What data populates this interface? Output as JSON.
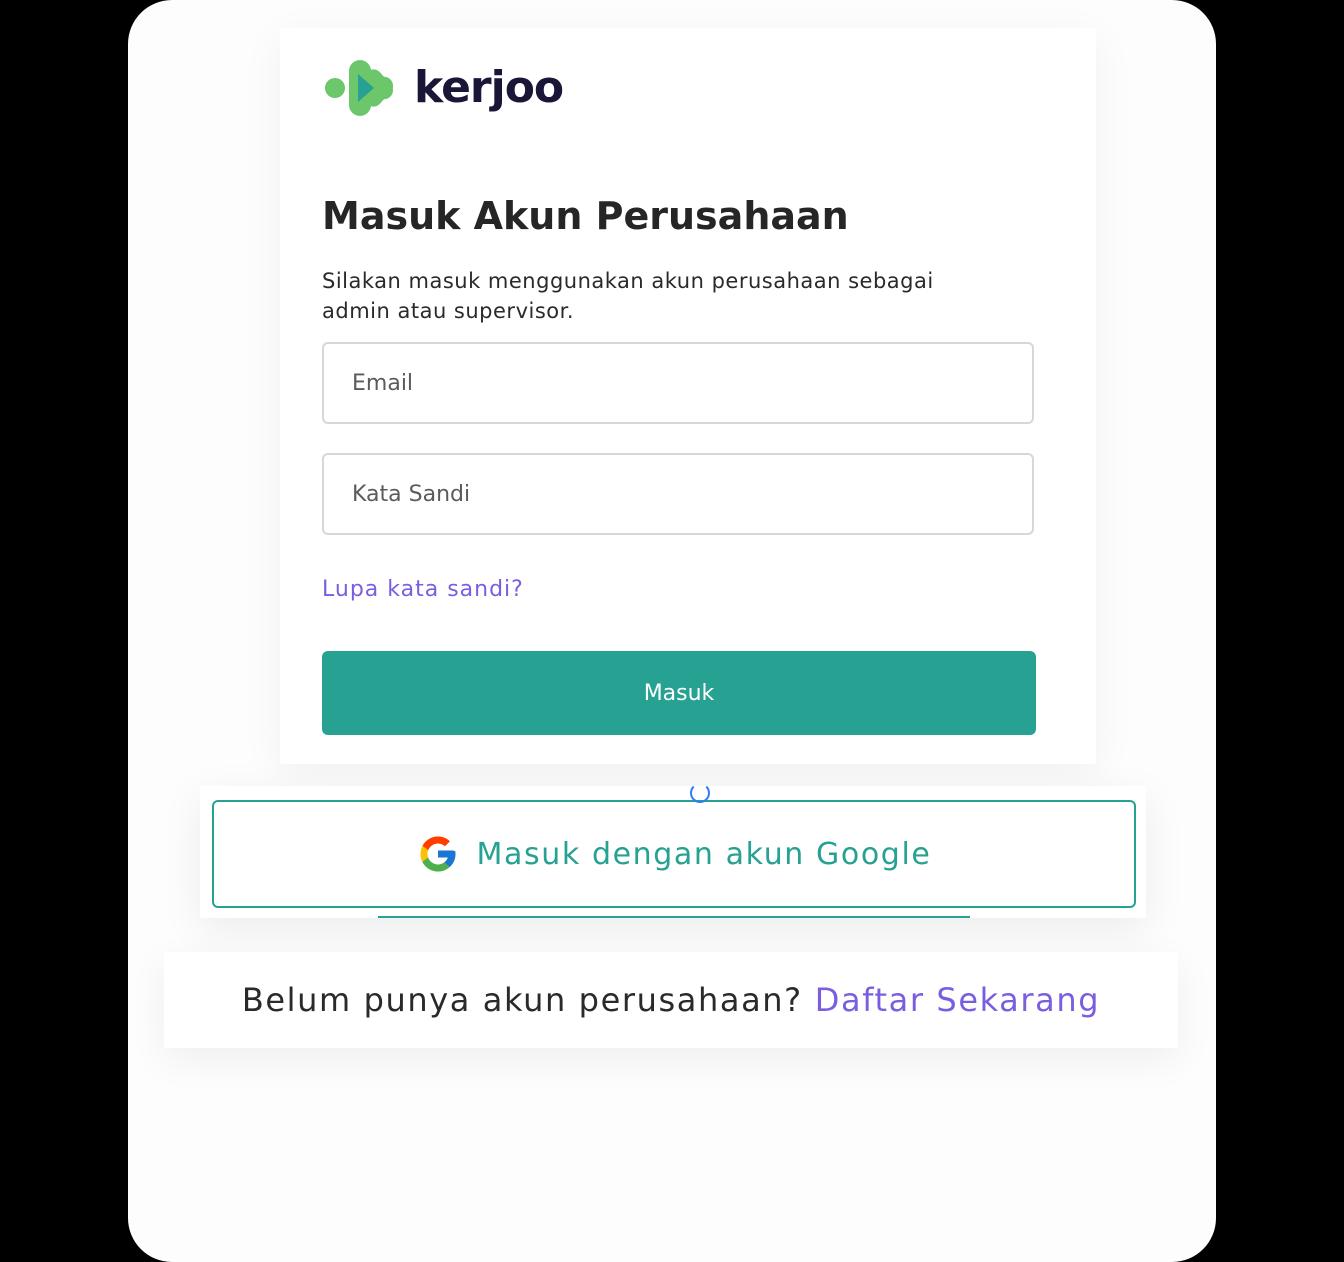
{
  "brand": {
    "name": "kerjoo",
    "colors": {
      "primary": "#26a192",
      "link": "#7b5ee0",
      "logo_green_light": "#6cc66a",
      "logo_teal": "#26a192",
      "wordmark": "#1a1638"
    }
  },
  "login": {
    "title": "Masuk Akun Perusahaan",
    "subtitle": "Silakan masuk menggunakan akun perusahaan sebagai admin atau supervisor.",
    "email_placeholder": "Email",
    "password_placeholder": "Kata Sandi",
    "forgot_link": "Lupa kata sandi?",
    "submit_label": "Masuk"
  },
  "google": {
    "label": "Masuk dengan akun Google",
    "icon": "google-g-icon"
  },
  "signup": {
    "text": "Belum punya akun perusahaan?",
    "link": "Daftar Sekarang"
  }
}
